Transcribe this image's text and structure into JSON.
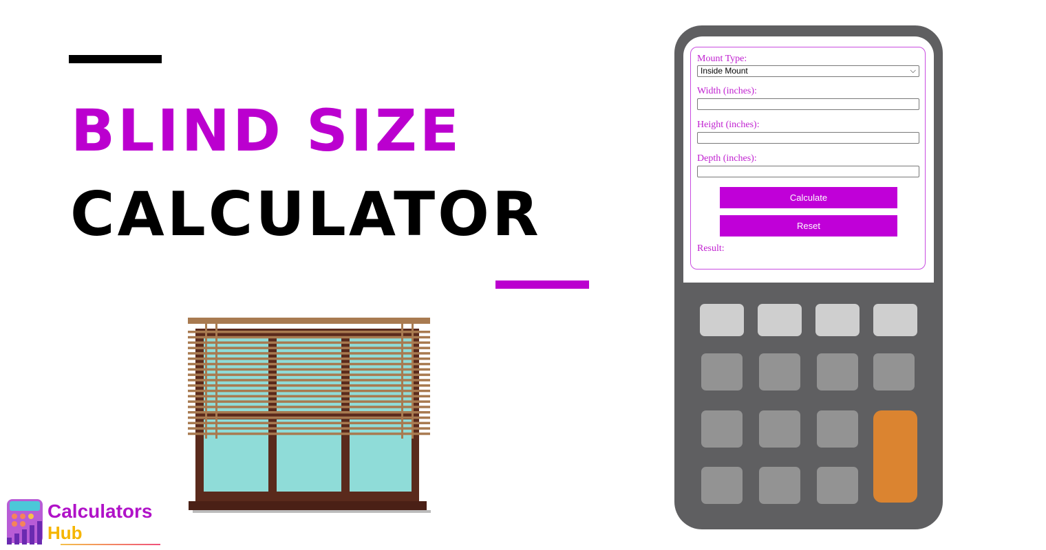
{
  "headline": {
    "line1": "BLIND SIZE",
    "line2": "CALCULATOR"
  },
  "colors": {
    "accent": "#bb00cf",
    "calculator_body": "#5f5f61",
    "orange_key": "#db8430"
  },
  "form": {
    "mount_type_label": "Mount Type:",
    "mount_type_value": "Inside Mount",
    "width_label": "Width (inches):",
    "width_value": "",
    "height_label": "Height (inches):",
    "height_value": "",
    "depth_label": "Depth (inches):",
    "depth_value": "",
    "calculate_label": "Calculate",
    "reset_label": "Reset",
    "result_label": "Result:"
  },
  "logo": {
    "line1": "Calculators",
    "line2": "Hub"
  },
  "icons": [
    "chevron-down-icon",
    "window-blinds-illustration",
    "calculator-logo-icon"
  ]
}
